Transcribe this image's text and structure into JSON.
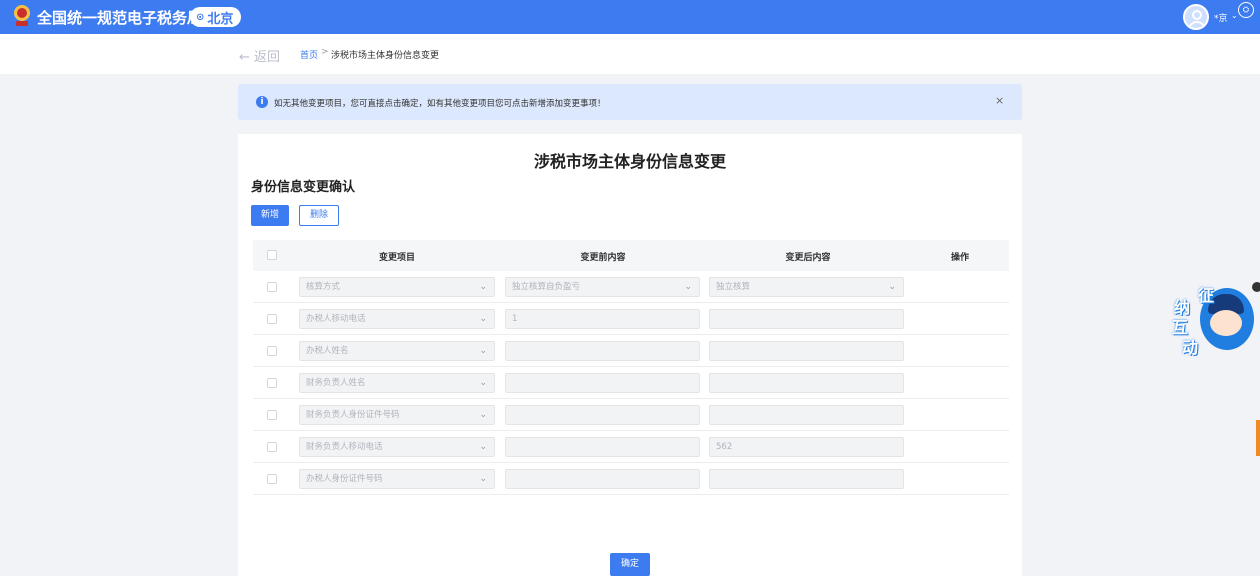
{
  "header": {
    "brand": "全国统一规范电子税务局",
    "region": "北京",
    "user_name": "*京",
    "emblem_color": "#c9302c"
  },
  "breadcrumb": {
    "back": "← 返回",
    "home": "首页",
    "separator": ">",
    "current": "涉税市场主体身份信息变更"
  },
  "notice": {
    "text": "如无其他变更项目，您可直接点击确定，如有其他变更项目您可点击新增添加变更事项！",
    "close": "×"
  },
  "card": {
    "title": "涉税市场主体身份信息变更",
    "section_title": "身份信息变更确认",
    "add_label": "新增",
    "delete_label": "删除",
    "confirm_label": "确定"
  },
  "table": {
    "headers": [
      "变更项目",
      "变更前内容",
      "变更后内容",
      "操作"
    ],
    "rows": [
      {
        "item": "核算方式",
        "before": "独立核算自负盈亏",
        "after": "独立核算",
        "before_is_select": true,
        "after_is_select": true
      },
      {
        "item": "办税人移动电话",
        "before": "1",
        "after": ""
      },
      {
        "item": "办税人姓名",
        "before": "",
        "after": ""
      },
      {
        "item": "财务负责人姓名",
        "before": "",
        "after": ""
      },
      {
        "item": "财务负责人身份证件号码",
        "before": "",
        "after": ""
      },
      {
        "item": "财务负责人移动电话",
        "before": "",
        "after": "562"
      },
      {
        "item": "办税人身份证件号码",
        "before": "",
        "after": ""
      }
    ]
  },
  "mascot": {
    "chars": [
      "征",
      "纳",
      "互",
      "动"
    ]
  },
  "colors": {
    "primary": "#3d7bf1",
    "notice_bg": "#dbe8fd",
    "page_bg": "#f2f3f7"
  }
}
